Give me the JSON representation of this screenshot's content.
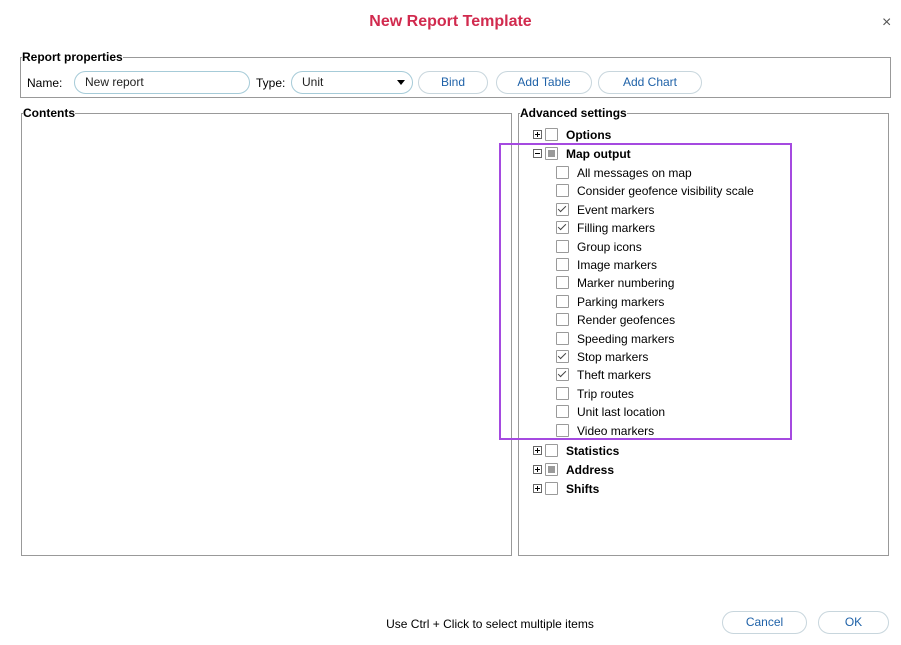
{
  "dialog": {
    "title": "New Report Template",
    "close_symbol": "×"
  },
  "report_properties": {
    "legend": "Report properties",
    "name_label": "Name:",
    "name_value": "New report",
    "type_label": "Type:",
    "type_value": "Unit",
    "bind_label": "Bind",
    "add_table_label": "Add Table",
    "add_chart_label": "Add Chart"
  },
  "contents": {
    "legend": "Contents"
  },
  "advanced": {
    "legend": "Advanced settings",
    "options_label": "Options",
    "map_output_label": "Map output",
    "map_output_items": [
      {
        "label": "All messages on map",
        "checked": false
      },
      {
        "label": "Consider geofence visibility scale",
        "checked": false
      },
      {
        "label": "Event markers",
        "checked": true
      },
      {
        "label": "Filling markers",
        "checked": true
      },
      {
        "label": "Group icons",
        "checked": false
      },
      {
        "label": "Image markers",
        "checked": false
      },
      {
        "label": "Marker numbering",
        "checked": false
      },
      {
        "label": "Parking markers",
        "checked": false
      },
      {
        "label": "Render geofences",
        "checked": false
      },
      {
        "label": "Speeding markers",
        "checked": false
      },
      {
        "label": "Stop markers",
        "checked": true
      },
      {
        "label": "Theft markers",
        "checked": true
      },
      {
        "label": "Trip routes",
        "checked": false
      },
      {
        "label": "Unit last location",
        "checked": false
      },
      {
        "label": "Video markers",
        "checked": false
      }
    ],
    "statistics_label": "Statistics",
    "address_label": "Address",
    "shifts_label": "Shifts"
  },
  "footer": {
    "hint": "Use Ctrl + Click to select multiple items",
    "cancel_label": "Cancel",
    "ok_label": "OK"
  },
  "colors": {
    "title": "#d12a4e",
    "button_text": "#1f62a8",
    "highlight": "#a54ae0"
  }
}
